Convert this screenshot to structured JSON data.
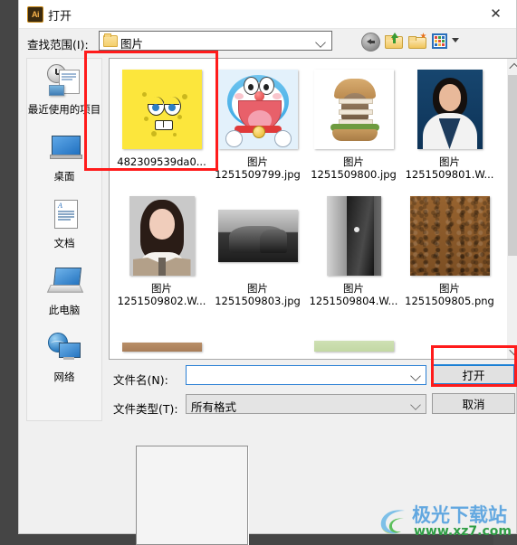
{
  "window": {
    "app_icon": "illustrator-ai-icon",
    "title": "打开",
    "close_label": "✕"
  },
  "lookin": {
    "label": "查找范围(I):",
    "value": "图片",
    "folder_icon": "folder-icon",
    "dropdown_icon": "chevron-down-icon"
  },
  "toolbar": {
    "buttons": [
      {
        "name": "back-button",
        "icon": "back-arrow-icon",
        "tooltip": "后退"
      },
      {
        "name": "up-one-level-button",
        "icon": "up-folder-icon",
        "tooltip": "向上一级"
      },
      {
        "name": "new-folder-button",
        "icon": "new-folder-icon",
        "tooltip": "新建文件夹"
      },
      {
        "name": "views-button",
        "icon": "views-grid-icon",
        "tooltip": "视图"
      }
    ],
    "views_caret": "caret-down-icon"
  },
  "places": [
    {
      "label": "最近使用的项目",
      "icon": "recent-items-icon"
    },
    {
      "label": "桌面",
      "icon": "desktop-icon"
    },
    {
      "label": "文档",
      "icon": "documents-icon"
    },
    {
      "label": "此电脑",
      "icon": "this-pc-icon"
    },
    {
      "label": "网络",
      "icon": "network-icon"
    }
  ],
  "files": [
    {
      "name": "482309539da0...",
      "thumb": "spongebob-yellow",
      "selected": true
    },
    {
      "name_line1": "图片",
      "name_line2": "1251509799.jpg",
      "thumb": "doraemon"
    },
    {
      "name_line1": "图片",
      "name_line2": "1251509800.jpg",
      "thumb": "cat-burger"
    },
    {
      "name_line1": "图片",
      "name_line2": "1251509801.W...",
      "thumb": "portrait-blue"
    },
    {
      "name_line1": "图片",
      "name_line2": "1251509802.W...",
      "thumb": "portrait-gray"
    },
    {
      "name_line1": "图片",
      "name_line2": "1251509803.jpg",
      "thumb": "rock-bw"
    },
    {
      "name_line1": "图片",
      "name_line2": "1251509804.W...",
      "thumb": "cliff-bw"
    },
    {
      "name_line1": "图片",
      "name_line2": "1251509805.png",
      "thumb": "leather-texture"
    }
  ],
  "filename": {
    "label": "文件名(N):",
    "value": "",
    "placeholder": "",
    "dropdown_icon": "chevron-down-icon"
  },
  "filetype": {
    "label": "文件类型(T):",
    "value": "所有格式",
    "dropdown_icon": "chevron-down-icon"
  },
  "buttons": {
    "open": "打开",
    "cancel": "取消"
  },
  "scrollbar": {
    "up_icon": "chevron-up-icon",
    "down_icon": "chevron-down-icon"
  },
  "annotations": [
    {
      "name": "highlight-selected-thumbnail",
      "color": "#ff1b1b"
    },
    {
      "name": "highlight-open-button",
      "color": "#ff1b1b"
    }
  ],
  "watermark": {
    "title": "极光下载站",
    "url": "www.xz7.com",
    "logo": "swirl-logo-icon"
  },
  "colors": {
    "accent_blue": "#1a7fd4",
    "annotation_red": "#ff1b1b",
    "dialog_bg": "#f0f0f0",
    "titlebar_bg": "#ffffff",
    "watermark_blue": "#63a8e0",
    "watermark_green": "#2f9e45"
  }
}
